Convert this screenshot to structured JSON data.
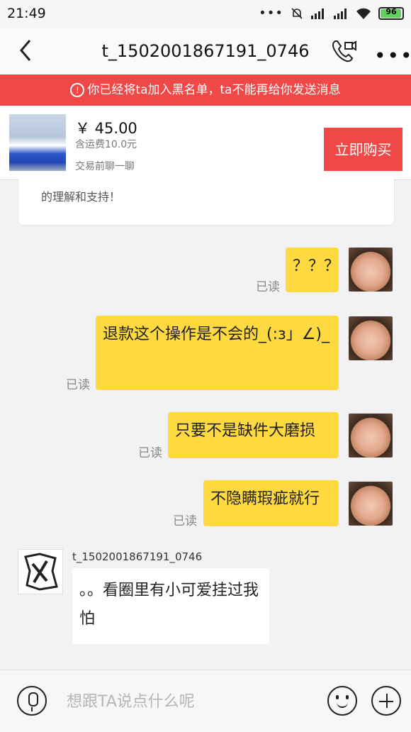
{
  "status_bar": {
    "time": "21:49",
    "dots": "•••",
    "battery": "96"
  },
  "header": {
    "title": "t_1502001867191_0746"
  },
  "banner": {
    "text": "你已经将ta加入黑名单，ta不能再给你发送消息"
  },
  "product": {
    "price": "￥ 45.00",
    "shipping": "含运费10.0元",
    "chat_before": "交易前聊一聊",
    "buy_label": "立即购买"
  },
  "previous_message": {
    "text": "的理解和支持！"
  },
  "messages": [
    {
      "text": "？？？",
      "status": "已读"
    },
    {
      "text": "退款这个操作是不会的_(:з」∠)_",
      "status": "已读"
    },
    {
      "text": "只要不是缺件大磨损",
      "status": "已读"
    },
    {
      "text": "不隐瞒瑕疵就行",
      "status": "已读"
    }
  ],
  "incoming": {
    "sender": "t_1502001867191_0746",
    "text": "。。看圈里有小可爱挂过我怕"
  },
  "input_bar": {
    "placeholder": "想跟TA说点什么呢"
  },
  "colors": {
    "accent": "#f04747",
    "bubble_me": "#ffd940"
  }
}
